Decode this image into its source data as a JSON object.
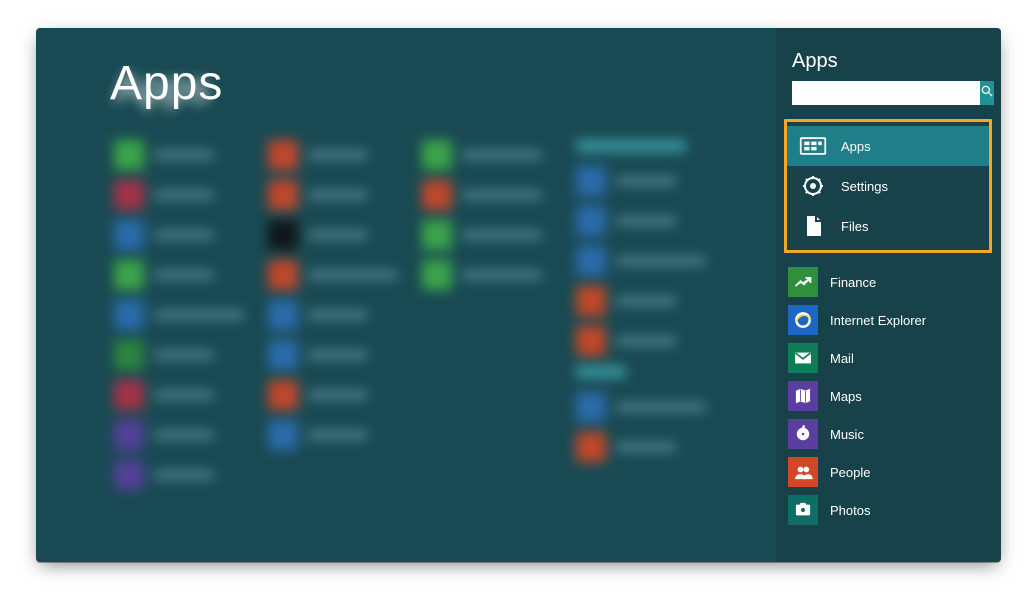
{
  "main": {
    "title": "Apps"
  },
  "search": {
    "title": "Apps",
    "placeholder": "",
    "value": "",
    "scopes": [
      {
        "id": "apps",
        "label": "Apps",
        "selected": true
      },
      {
        "id": "settings",
        "label": "Settings",
        "selected": false
      },
      {
        "id": "files",
        "label": "Files",
        "selected": false
      }
    ],
    "suggestions": [
      {
        "id": "finance",
        "label": "Finance",
        "color": "#2f8f3d"
      },
      {
        "id": "ie",
        "label": "Internet Explorer",
        "color": "#1e66c4"
      },
      {
        "id": "mail",
        "label": "Mail",
        "color": "#0f7b57"
      },
      {
        "id": "maps",
        "label": "Maps",
        "color": "#5a3fa0"
      },
      {
        "id": "music",
        "label": "Music",
        "color": "#5a3fa0"
      },
      {
        "id": "people",
        "label": "People",
        "color": "#d24726"
      },
      {
        "id": "photos",
        "label": "Photos",
        "color": "#0f6d66"
      }
    ]
  },
  "colors": {
    "accent": "#1f939a",
    "highlight": "#f5a623",
    "pane": "#174249",
    "surface": "#194a53"
  }
}
